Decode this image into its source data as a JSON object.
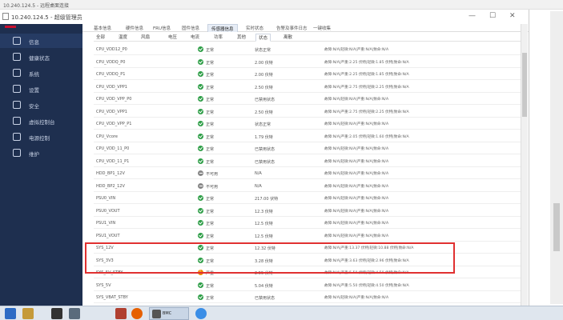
{
  "window": {
    "title": "10.240.124.5 - 远程桌面连接",
    "remote_title": "10.240.124.5 - 超级管理员"
  },
  "sidebar": {
    "items": [
      {
        "label": "信息",
        "icon": "grid-icon",
        "active": true
      },
      {
        "label": "健康状态",
        "icon": "heart-icon",
        "active": false
      },
      {
        "label": "系统",
        "icon": "sliders-icon",
        "active": false
      },
      {
        "label": "设置",
        "icon": "gear-icon",
        "active": false
      },
      {
        "label": "安全",
        "icon": "shield-icon",
        "active": false
      },
      {
        "label": "虚拟控制台",
        "icon": "console-icon",
        "active": false
      },
      {
        "label": "电源控制",
        "icon": "power-icon",
        "active": false
      },
      {
        "label": "维护",
        "icon": "wrench-icon",
        "active": false
      }
    ]
  },
  "top_tabs": [
    {
      "label": "基本信息",
      "active": false
    },
    {
      "label": "硬件信息",
      "active": false
    },
    {
      "label": "FRU信息",
      "active": false
    },
    {
      "label": "固件信息",
      "active": false
    },
    {
      "label": "传感器信息",
      "active": true
    },
    {
      "label": "实时状态",
      "active": false
    },
    {
      "label": "告警及事件日志",
      "active": false
    },
    {
      "label": "一键收集",
      "active": false
    }
  ],
  "sub_tabs": [
    {
      "label": "全部",
      "active": false
    },
    {
      "label": "温度",
      "active": false
    },
    {
      "label": "风扇",
      "active": false
    },
    {
      "label": "电压",
      "active": false
    },
    {
      "label": "电流",
      "active": false
    },
    {
      "label": "功率",
      "active": false
    },
    {
      "label": "其他",
      "active": false
    },
    {
      "label": "状态",
      "active": true
    },
    {
      "label": "离散",
      "active": false
    }
  ],
  "sensor_rows": [
    {
      "name": "CPU_VDD12_P0",
      "status": "ok",
      "status_text": "正常",
      "reading": "状态正常",
      "threshold": "故障:N/A|轻微:N/A|严重:N/A|致命:N/A"
    },
    {
      "name": "CPU_VDDQ_P0",
      "status": "ok",
      "status_text": "正常",
      "reading": "2.00 伏特",
      "threshold": "故障:N/A|严重:2.25 伏特|轻微:1.85 伏特|致命:N/A"
    },
    {
      "name": "CPU_VDDQ_P1",
      "status": "ok",
      "status_text": "正常",
      "reading": "2.00 伏特",
      "threshold": "故障:N/A|严重:2.25 伏特|轻微:1.85 伏特|致命:N/A"
    },
    {
      "name": "CPU_VDD_VPP1",
      "status": "ok",
      "status_text": "正常",
      "reading": "2.50 伏特",
      "threshold": "故障:N/A|严重:2.75 伏特|轻微:2.25 伏特|致命:N/A"
    },
    {
      "name": "CPU_VDD_VPP_P0",
      "status": "ok",
      "status_text": "正常",
      "reading": "已禁用状态",
      "threshold": "故障:N/A|轻微:N/A|严重:N/A|致命:N/A"
    },
    {
      "name": "CPU_VDD_VPP1",
      "status": "ok",
      "status_text": "正常",
      "reading": "2.50 伏特",
      "threshold": "故障:N/A|严重:2.75 伏特|轻微:2.25 伏特|致命:N/A"
    },
    {
      "name": "CPU_VDD_VPP_P1",
      "status": "ok",
      "status_text": "正常",
      "reading": "状态正常",
      "threshold": "故障:N/A|轻微:N/A|严重:N/A|致命:N/A"
    },
    {
      "name": "CPU_Vcore",
      "status": "ok",
      "status_text": "正常",
      "reading": "1.79 伏特",
      "threshold": "故障:N/A|严重:2.05 伏特|轻微:1.60 伏特|致命:N/A"
    },
    {
      "name": "CPU_VDD_11_P0",
      "status": "ok",
      "status_text": "正常",
      "reading": "已禁用状态",
      "threshold": "故障:N/A|轻微:N/A|严重:N/A|致命:N/A"
    },
    {
      "name": "CPU_VDD_11_P1",
      "status": "ok",
      "status_text": "正常",
      "reading": "已禁用状态",
      "threshold": "故障:N/A|轻微:N/A|严重:N/A|致命:N/A"
    },
    {
      "name": "HDD_BP1_12V",
      "status": "off",
      "status_text": "不可用",
      "reading": "N/A",
      "threshold": "故障:N/A|轻微:N/A|严重:N/A|致命:N/A"
    },
    {
      "name": "HDD_BP2_12V",
      "status": "off",
      "status_text": "不可用",
      "reading": "N/A",
      "threshold": "故障:N/A|轻微:N/A|严重:N/A|致命:N/A"
    },
    {
      "name": "PSU0_VIN",
      "status": "ok",
      "status_text": "正常",
      "reading": "217.00 伏特",
      "threshold": "故障:N/A|轻微:N/A|严重:N/A|致命:N/A"
    },
    {
      "name": "PSU0_VOUT",
      "status": "ok",
      "status_text": "正常",
      "reading": "12.3 伏特",
      "threshold": "故障:N/A|轻微:N/A|严重:N/A|致命:N/A"
    },
    {
      "name": "PSU1_VIN",
      "status": "ok",
      "status_text": "正常",
      "reading": "12.5 伏特",
      "threshold": "故障:N/A|轻微:N/A|严重:N/A|致命:N/A"
    },
    {
      "name": "PSU1_VOUT",
      "status": "ok",
      "status_text": "正常",
      "reading": "12.5 伏特",
      "threshold": "故障:N/A|轻微:N/A|严重:N/A|致命:N/A"
    },
    {
      "name": "SYS_12V",
      "status": "ok",
      "status_text": "正常",
      "reading": "12.32 伏特",
      "threshold": "故障:N/A|严重:13.37 伏特|轻微:10.88 伏特|致命:N/A"
    },
    {
      "name": "SYS_3V3",
      "status": "ok",
      "status_text": "正常",
      "reading": "3.28 伏特",
      "threshold": "故障:N/A|严重:3.63 伏特|轻微:2.96 伏特|致命:N/A"
    },
    {
      "name": "SYS_5V_STBY",
      "status": "warn",
      "status_text": "严重",
      "reading": "2.55 伏特",
      "threshold": "故障:N/A|严重:5.50 伏特|轻微:4.50 伏特|致命:N/A"
    },
    {
      "name": "SYS_5V",
      "status": "ok",
      "status_text": "正常",
      "reading": "5.04 伏特",
      "threshold": "故障:N/A|严重:5.50 伏特|轻微:4.50 伏特|致命:N/A"
    },
    {
      "name": "SYS_VBAT_STBY",
      "status": "ok",
      "status_text": "正常",
      "reading": "已禁用状态",
      "threshold": "故障:N/A|轻微:N/A|严重:N/A|致命:N/A"
    }
  ],
  "taskbar": {
    "items": [
      {
        "label": "",
        "icon": "start-icon"
      },
      {
        "label": "",
        "icon": "explorer-icon"
      },
      {
        "label": "",
        "icon": "terminal-icon"
      },
      {
        "label": "",
        "icon": "server-icon"
      },
      {
        "label": "",
        "icon": "app-icon"
      },
      {
        "label": "",
        "icon": "firefox-icon"
      },
      {
        "label": "BMC",
        "icon": "bmc-icon"
      },
      {
        "label": "",
        "icon": "chrome-icon"
      }
    ]
  },
  "colors": {
    "sidebar_bg": "#1e2f4f",
    "status_ok": "#2e9e47",
    "status_warn": "#f08a00",
    "status_off": "#888888",
    "highlight": "#e03030"
  }
}
